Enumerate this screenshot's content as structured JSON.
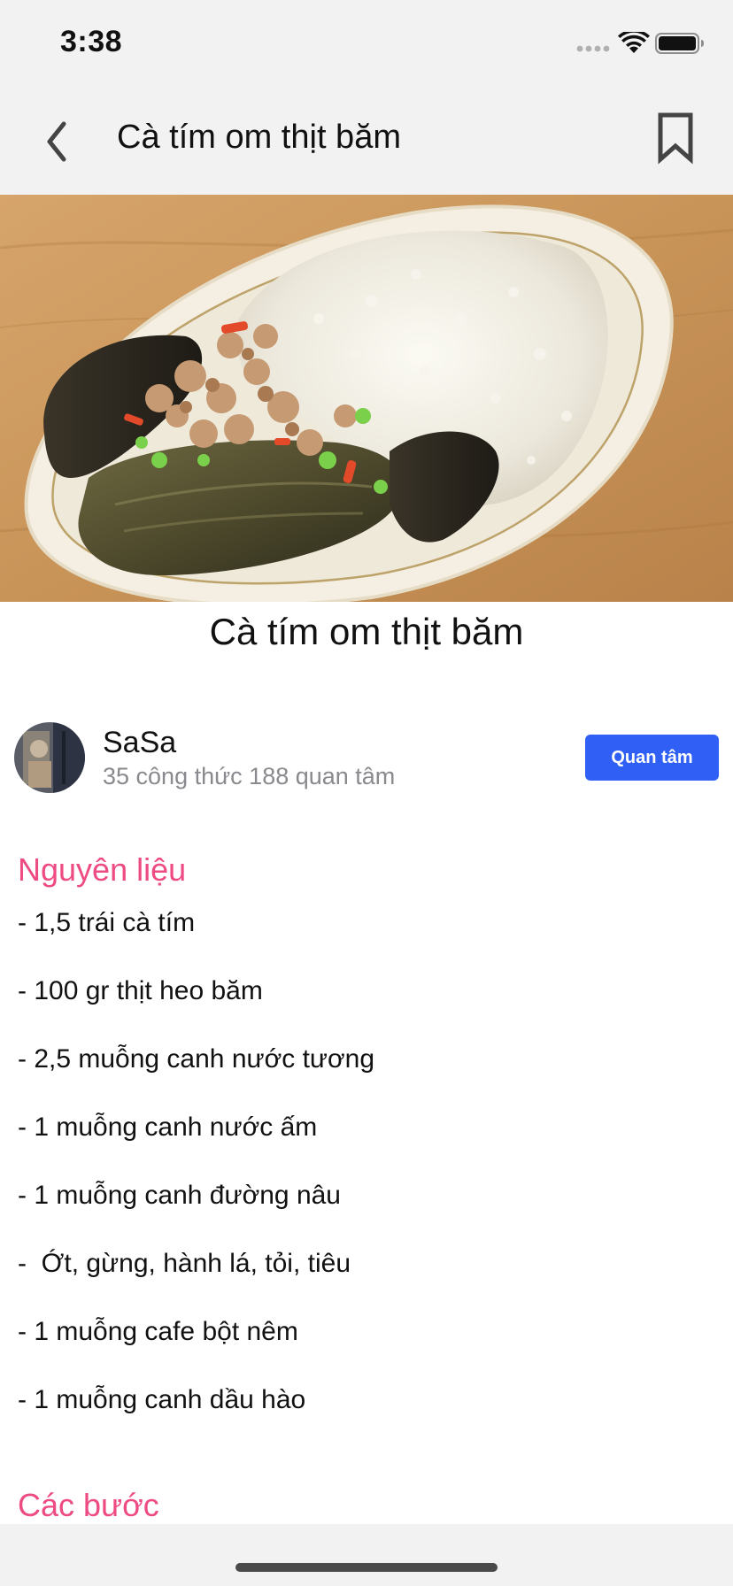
{
  "status_bar": {
    "time": "3:38"
  },
  "nav": {
    "title": "Cà tím om thịt băm"
  },
  "recipe": {
    "title": "Cà tím om thịt băm"
  },
  "author": {
    "name": "SaSa",
    "stats": "35 công thức 188 quan tâm",
    "follow_label": "Quan tâm"
  },
  "ingredients": {
    "heading": "Nguyên liệu",
    "items": [
      "- 1,5 trái cà tím",
      "- 100 gr thịt heo băm",
      "- 2,5 muỗng canh nước tương",
      "- 1 muỗng canh nước ấm",
      "- 1 muỗng canh đường nâu",
      "-  Ớt, gừng, hành lá, tỏi, tiêu",
      "- 1 muỗng cafe bột nêm",
      "- 1 muỗng canh dầu hào"
    ]
  },
  "steps": {
    "heading": "Các bước"
  },
  "colors": {
    "accent_pink": "#ee4a83",
    "follow_blue": "#2f5ff5",
    "bar_gray": "#f2f2f2",
    "secondary_text": "#8a8a8e"
  },
  "icons": {
    "back": "chevron-left-icon",
    "bookmark": "bookmark-icon",
    "signal": "cellular-signal-icon",
    "wifi": "wifi-icon",
    "battery": "battery-icon"
  }
}
